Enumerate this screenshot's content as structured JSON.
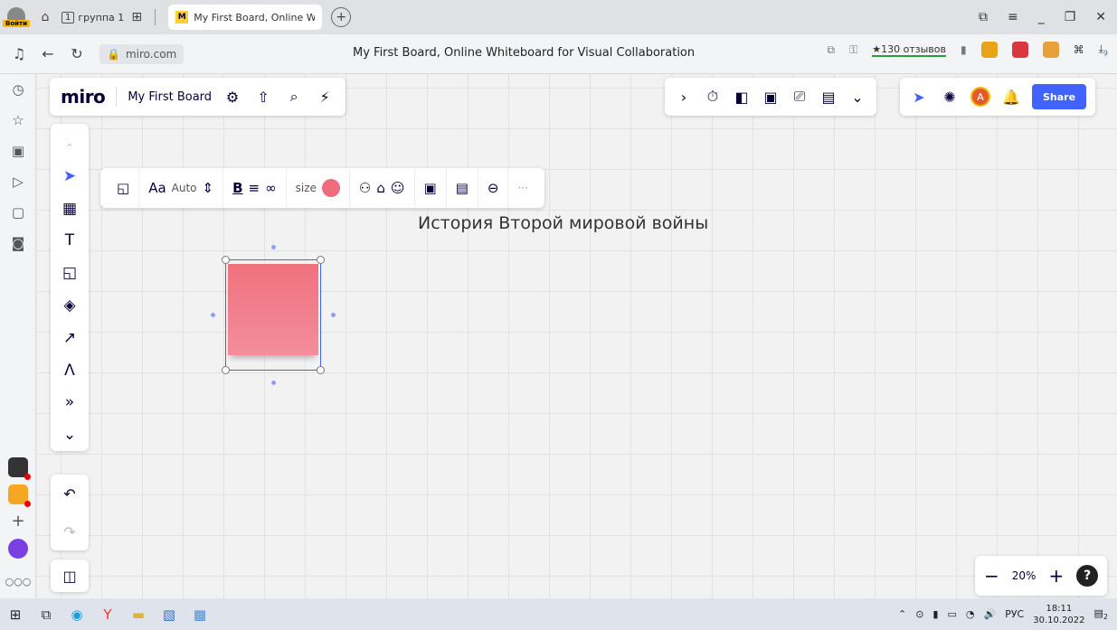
{
  "browser": {
    "login_label": "Войти",
    "group_tab": {
      "number": "1",
      "label": "группа 1"
    },
    "active_tab": {
      "title": "My First Board, Online W ×",
      "favicon": "miro-icon"
    },
    "url": "miro.com",
    "page_title": "My First Board, Online Whiteboard for Visual Collaboration",
    "reviews": "★130 отзывов",
    "download_badge": "9"
  },
  "board": {
    "logo": "miro",
    "name": "My First Board",
    "share_label": "Share",
    "avatar_initial": "A",
    "text_item": "История Второй мировой войны",
    "zoom": "20%",
    "help": "?"
  },
  "context_toolbar": {
    "font_size": "Auto",
    "size_label": "size",
    "more": "···",
    "note_color": "#ef6c7d"
  },
  "taskbar": {
    "lang": "РУС",
    "time": "18:11",
    "date": "30.10.2022",
    "notif": "2"
  },
  "colors": {
    "accent": "#4262ff",
    "sticky": "#f07a8a",
    "miro_yellow": "#ffd02f"
  }
}
